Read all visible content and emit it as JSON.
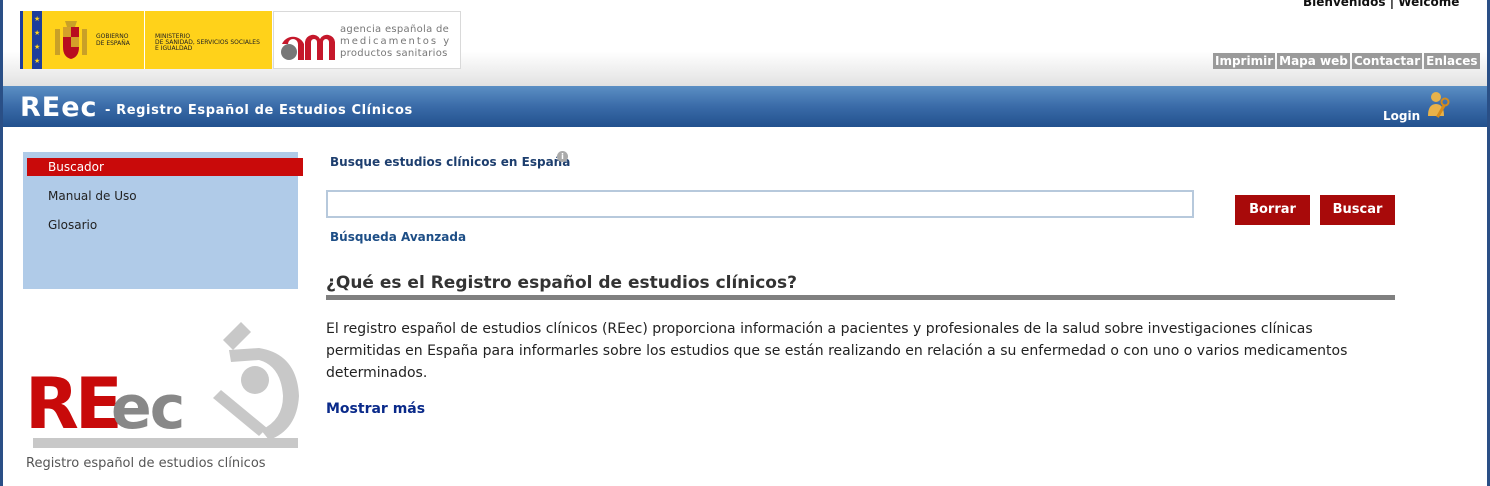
{
  "header": {
    "welcome": "Bienvenidos | Welcome",
    "gov_logo": {
      "line1": "GOBIERNO",
      "line2": "DE ESPAÑA",
      "ministry1": "MINISTERIO",
      "ministry2": "DE SANIDAD, SERVICIOS SOCIALES",
      "ministry3": "E IGUALDAD"
    },
    "aemps": {
      "line1": "agencia española de",
      "line2": "medicamentos y",
      "line3": "productos sanitarios"
    },
    "nav": [
      "Imprimir",
      "Mapa web",
      "Contactar",
      "Enlaces"
    ]
  },
  "bar": {
    "brand": "REec",
    "subtitle": "- Registro Español de Estudios Clínicos",
    "login": "Login",
    "login_icon": "user-key-icon"
  },
  "sidebar": {
    "items": [
      {
        "label": "Buscador",
        "active": true
      },
      {
        "label": "Manual de Uso",
        "active": false
      },
      {
        "label": "Glosario",
        "active": false
      }
    ],
    "logo_caption": "Registro español de estudios clínicos"
  },
  "main": {
    "search_label": "Busque estudios clínicos en España",
    "search_value": "",
    "clear_button": "Borrar",
    "search_button": "Buscar",
    "advanced_link": "Búsqueda Avanzada",
    "heading": "¿Qué es el Registro español de estudios clínicos?",
    "paragraph": "El registro español de estudios clínicos (REec) proporciona información a pacientes y profesionales de la salud sobre investigaciones clínicas permitidas en España para informarles sobre los estudios que se están realizando en relación a su enfermedad o con uno o varios medicamentos determinados.",
    "show_more": "Mostrar más"
  },
  "colors": {
    "accent_red": "#a80a0a",
    "bar_blue": "#2b5c99",
    "sidebar_blue": "#b0cbe8"
  }
}
